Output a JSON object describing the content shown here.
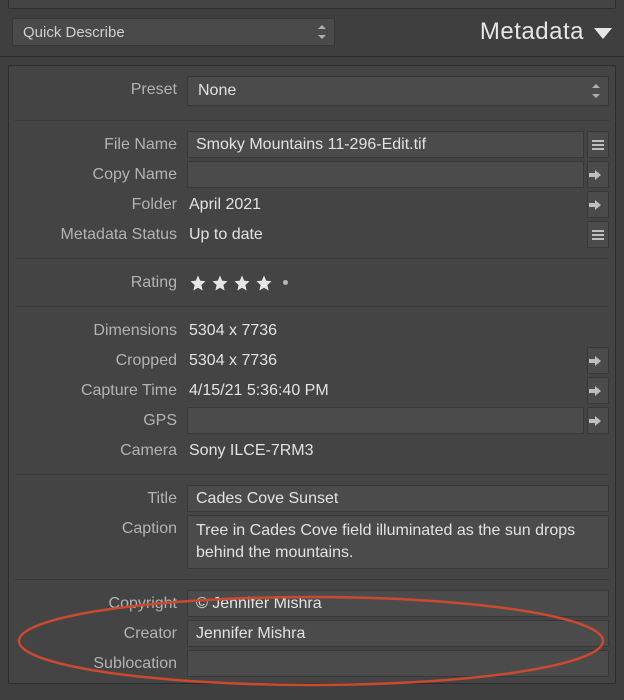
{
  "header": {
    "template": "Quick Describe",
    "title": "Metadata"
  },
  "preset": {
    "label": "Preset",
    "value": "None"
  },
  "groups": {
    "file": {
      "file_name": {
        "label": "File Name",
        "value": "Smoky Mountains 11-296-Edit.tif"
      },
      "copy_name": {
        "label": "Copy Name",
        "value": ""
      },
      "folder": {
        "label": "Folder",
        "value": "April 2021"
      },
      "metadata_status": {
        "label": "Metadata Status",
        "value": "Up to date"
      }
    },
    "rating": {
      "label": "Rating",
      "value": 4,
      "max": 5
    },
    "image": {
      "dimensions": {
        "label": "Dimensions",
        "value": "5304 x 7736"
      },
      "cropped": {
        "label": "Cropped",
        "value": "5304 x 7736"
      },
      "capture_time": {
        "label": "Capture Time",
        "value": "4/15/21 5:36:40 PM"
      },
      "gps": {
        "label": "GPS",
        "value": ""
      },
      "camera": {
        "label": "Camera",
        "value": "Sony ILCE-7RM3"
      }
    },
    "content": {
      "title": {
        "label": "Title",
        "value": "Cades Cove Sunset"
      },
      "caption": {
        "label": "Caption",
        "value": "Tree in Cades Cove field illuminated as the sun drops behind the mountains."
      }
    },
    "iptc": {
      "copyright": {
        "label": "Copyright",
        "value": "© Jennifer Mishra"
      },
      "creator": {
        "label": "Creator",
        "value": "Jennifer Mishra"
      },
      "sublocation": {
        "label": "Sublocation",
        "value": ""
      }
    }
  },
  "colors": {
    "annotation": "#c94a2f"
  }
}
